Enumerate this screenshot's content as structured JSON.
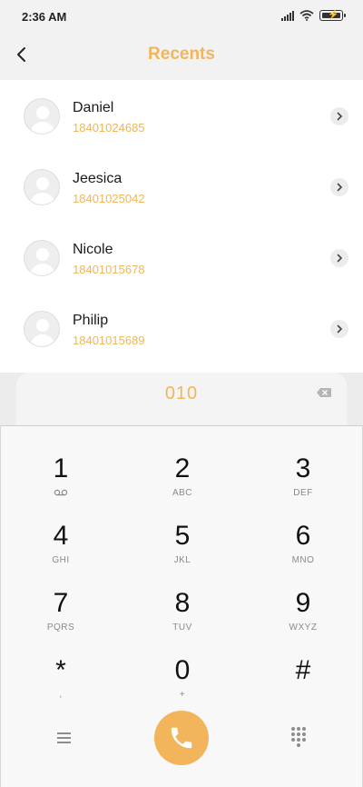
{
  "status_bar": {
    "time": "2:36 AM",
    "icons": [
      "signal-icon",
      "wifi-icon",
      "battery-charging-icon"
    ]
  },
  "header": {
    "title": "Recents",
    "back_icon": "chevron-left-icon"
  },
  "contacts": [
    {
      "name": "Daniel",
      "number": "18401024685"
    },
    {
      "name": "Jeesica",
      "number": "18401025042"
    },
    {
      "name": "Nicole",
      "number": "18401015678"
    },
    {
      "name": "Philip",
      "number": "18401015689"
    }
  ],
  "dialer": {
    "dialed_number": "010",
    "keys": [
      {
        "digit": "1",
        "letters": "voicemail-icon"
      },
      {
        "digit": "2",
        "letters": "ABC"
      },
      {
        "digit": "3",
        "letters": "DEF"
      },
      {
        "digit": "4",
        "letters": "GHI"
      },
      {
        "digit": "5",
        "letters": "JKL"
      },
      {
        "digit": "6",
        "letters": "MNO"
      },
      {
        "digit": "7",
        "letters": "PQRS"
      },
      {
        "digit": "8",
        "letters": "TUV"
      },
      {
        "digit": "9",
        "letters": "WXYZ"
      },
      {
        "digit": "*",
        "letters": ","
      },
      {
        "digit": "0",
        "letters": "+"
      },
      {
        "digit": "#",
        "letters": ""
      }
    ]
  },
  "colors": {
    "accent": "#f1b659",
    "call_button": "#f2b55b",
    "background": "#f2f2f2"
  }
}
